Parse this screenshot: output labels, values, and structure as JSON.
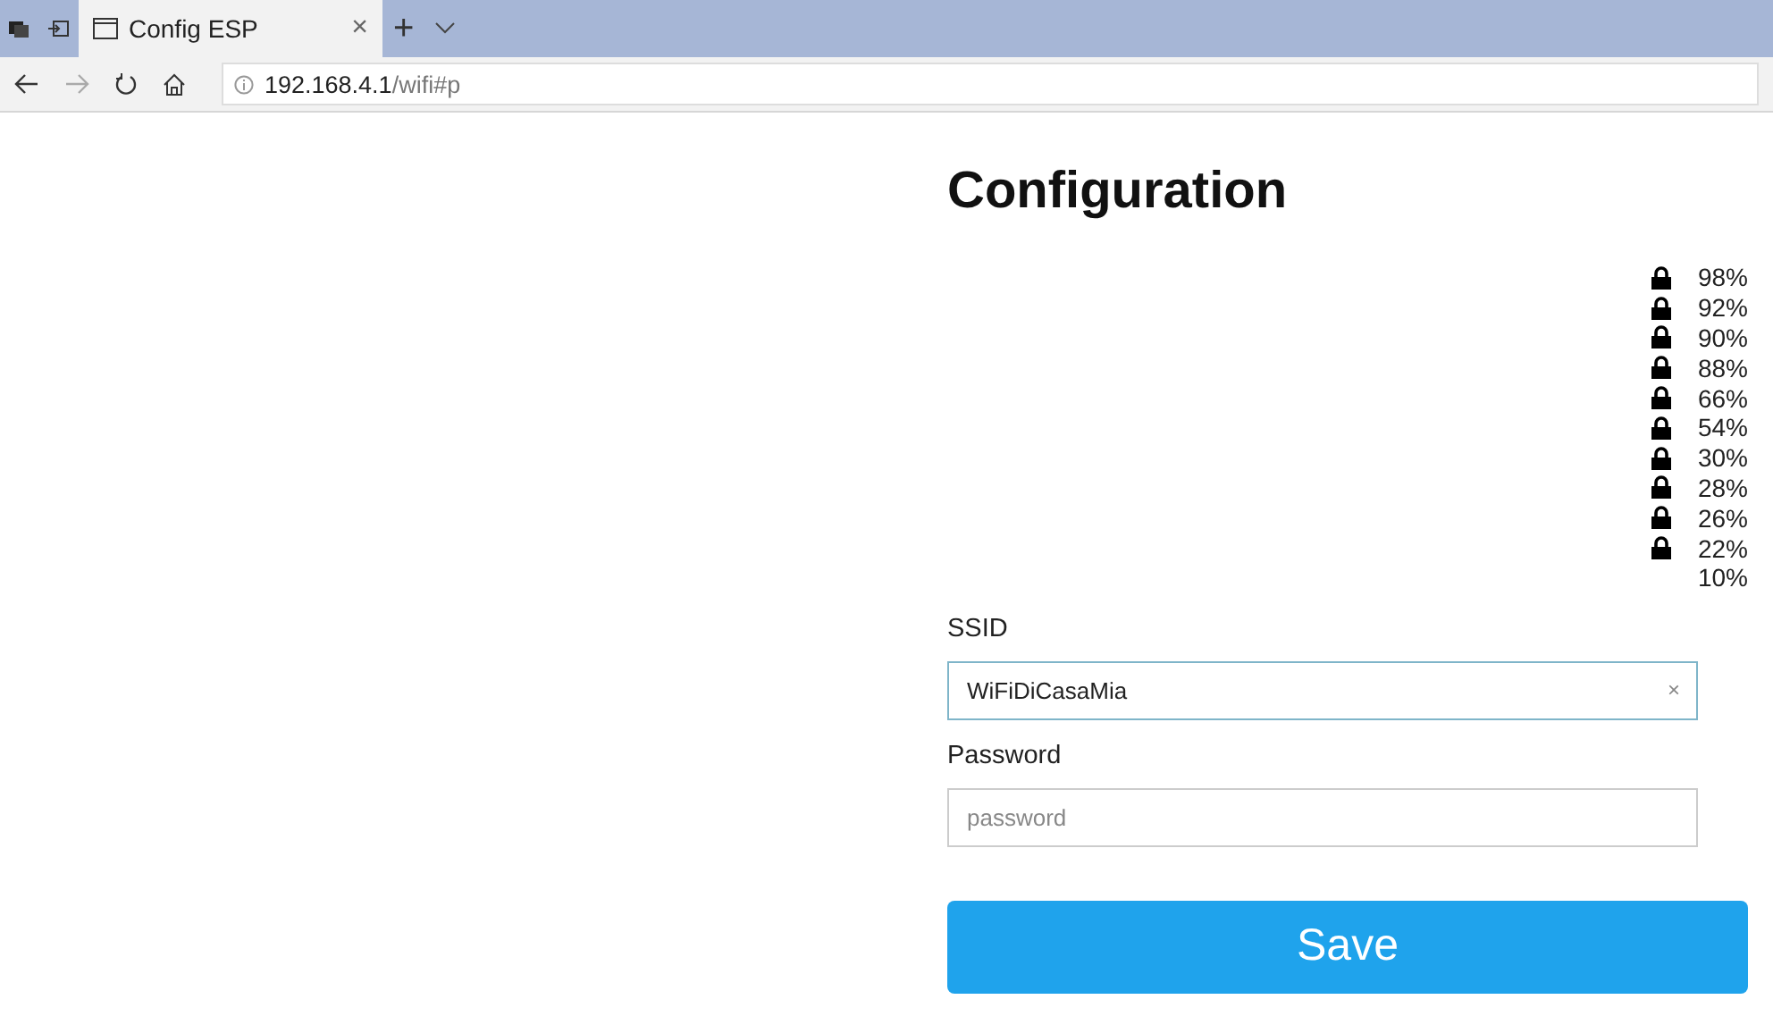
{
  "browser": {
    "tab": {
      "title": "Config ESP",
      "close": "×",
      "selected": true
    },
    "new_tab": "+",
    "address": {
      "host": "192.168.4.1",
      "path": "/wifi#p"
    }
  },
  "page": {
    "heading": "Configuration",
    "networks": [
      {
        "secured": true,
        "quality": "98%"
      },
      {
        "secured": true,
        "quality": "92%"
      },
      {
        "secured": true,
        "quality": "90%"
      },
      {
        "secured": true,
        "quality": "88%"
      },
      {
        "secured": true,
        "quality": "66%"
      },
      {
        "secured": true,
        "quality": "54%"
      },
      {
        "secured": true,
        "quality": "30%"
      },
      {
        "secured": true,
        "quality": "28%"
      },
      {
        "secured": true,
        "quality": "26%"
      },
      {
        "secured": true,
        "quality": "22%"
      },
      {
        "secured": false,
        "quality": "10%"
      }
    ],
    "ssid": {
      "label": "SSID",
      "value": "WiFiDiCasaMia",
      "clear": "×"
    },
    "password": {
      "label": "Password",
      "placeholder": "password"
    },
    "save": "Save"
  }
}
